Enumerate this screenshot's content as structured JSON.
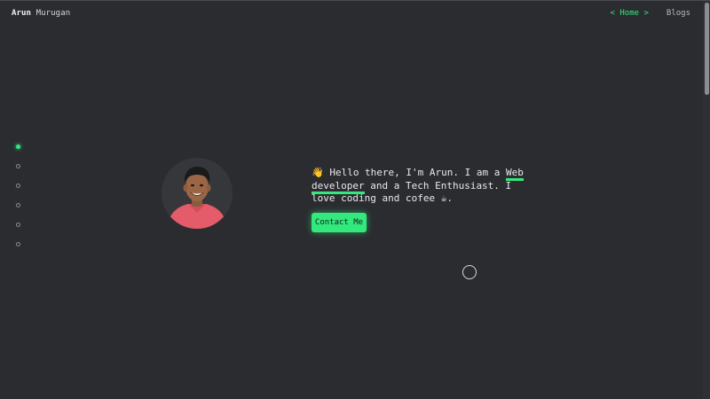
{
  "header": {
    "first_name": "Arun",
    "last_name": "Murugan",
    "nav": {
      "home": "< Home >",
      "blogs": "Blogs"
    }
  },
  "section_dots": {
    "count": 6,
    "active_index": 0
  },
  "hero": {
    "wave_emoji": "👋",
    "text_before": " Hello there, I'm Arun. I am a ",
    "highlight": "Web developer",
    "text_after": " and a Tech Enthusiast. I love coding and cofee ",
    "coffee_emoji": "☕",
    "text_end": ".",
    "contact_button": "Contact Me"
  },
  "colors": {
    "accent": "#31e97c",
    "background": "#2b2c30"
  }
}
